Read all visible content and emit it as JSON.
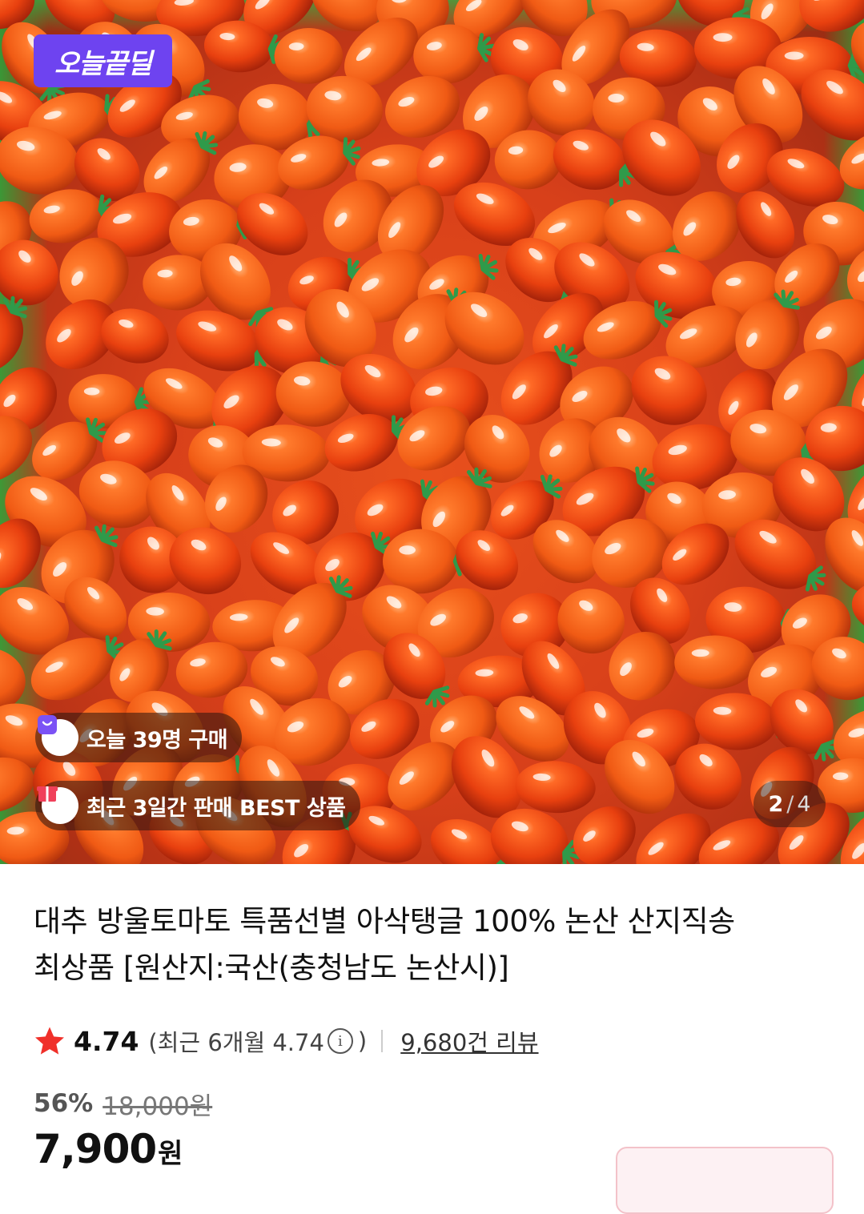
{
  "hero": {
    "deal_badge": "오늘끝딜",
    "buyers_today": "오늘 39명 구매",
    "best_label": "최근 3일간 판매 BEST 상품",
    "pager": {
      "current": "2",
      "separator": "/",
      "total": "4"
    }
  },
  "product": {
    "title_line1": "대추 방울토마토 특품선별 아삭탱글 100% 논산 산지직송",
    "title_line2": "최상품 [원산지:국산(충청남도 논산시)]",
    "rating": "4.74",
    "recent_rating_prefix": "(최근 6개월 4.74",
    "recent_rating_suffix": ")",
    "info_symbol": "i",
    "review_count": "9,680건 리뷰",
    "discount_rate": "56%",
    "original_price": "18,000원",
    "price": "7,900",
    "price_unit": "원"
  },
  "colors": {
    "deal_badge": "#6e43f0",
    "star": "#f0302a",
    "coupon_border": "#f3c2c9"
  },
  "icons": [
    "shopping-bag-icon",
    "gift-box-icon",
    "star-icon",
    "info-icon"
  ]
}
